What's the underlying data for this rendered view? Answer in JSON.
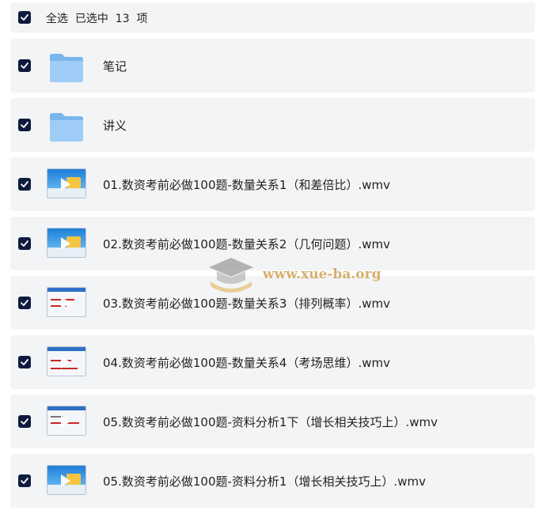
{
  "header": {
    "select_all_label": "全选  已选中  13  项"
  },
  "items": [
    {
      "name": "笔记",
      "type": "folder"
    },
    {
      "name": "讲义",
      "type": "folder"
    },
    {
      "name": "01.数资考前必做100题-数量关系1（和差倍比）.wmv",
      "type": "video"
    },
    {
      "name": "02.数资考前必做100题-数量关系2（几何问题）.wmv",
      "type": "video"
    },
    {
      "name": "03.数资考前必做100题-数量关系3（排列概率）.wmv",
      "type": "video-doc"
    },
    {
      "name": "04.数资考前必做100题-数量关系4（考场思维）.wmv",
      "type": "video-doc"
    },
    {
      "name": "05.数资考前必做100题-资料分析1下（增长相关技巧上）.wmv",
      "type": "video-doc"
    },
    {
      "name": "05.数资考前必做100题-资料分析1（增长相关技巧上）.wmv",
      "type": "video"
    }
  ],
  "watermark": {
    "text": "www.xue-ba.org"
  },
  "colors": {
    "checkbox": "#0d1b3e",
    "row_bg": "#f3f4f6",
    "folder": "#8cc4f5"
  }
}
